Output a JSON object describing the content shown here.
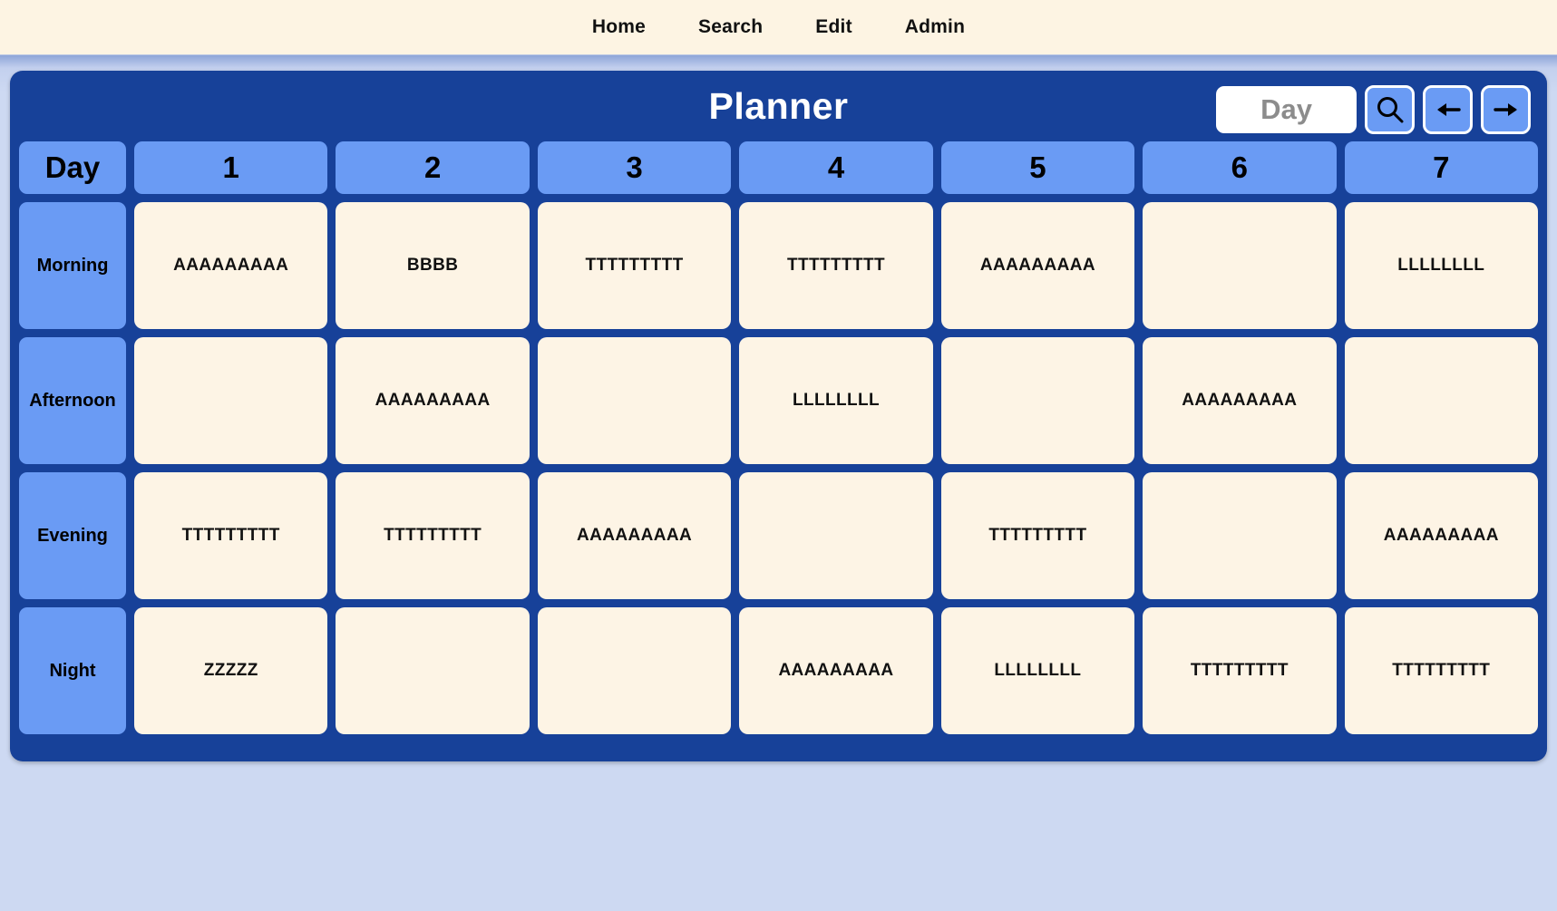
{
  "nav": {
    "items": [
      {
        "label": "Home"
      },
      {
        "label": "Search"
      },
      {
        "label": "Edit"
      },
      {
        "label": "Admin"
      }
    ]
  },
  "header": {
    "title": "Planner",
    "search_input": {
      "value": "",
      "placeholder": "Day"
    },
    "buttons": [
      {
        "name": "search-button",
        "icon": "search-icon"
      },
      {
        "name": "previous-button",
        "icon": "arrow-left-icon"
      },
      {
        "name": "next-button",
        "icon": "arrow-right-icon"
      }
    ]
  },
  "grid": {
    "corner_label": "Day",
    "day_headers": [
      "1",
      "2",
      "3",
      "4",
      "5",
      "6",
      "7"
    ],
    "row_labels": [
      "Morning",
      "Afternoon",
      "Evening",
      "Night"
    ],
    "rows": [
      [
        "AAAAAAAAA",
        "BBBB",
        "TTTTTTTTT",
        "TTTTTTTTT",
        "AAAAAAAAA",
        "",
        "LLLLLLLL"
      ],
      [
        "",
        "AAAAAAAAA",
        "",
        "LLLLLLLL",
        "",
        "AAAAAAAAA",
        ""
      ],
      [
        "TTTTTTTTT",
        "TTTTTTTTT",
        "AAAAAAAAA",
        "",
        "TTTTTTTTT",
        "",
        "AAAAAAAAA"
      ],
      [
        "ZZZZZ",
        "",
        "",
        "AAAAAAAAA",
        "LLLLLLLL",
        "TTTTTTTTT",
        "TTTTTTTTT"
      ]
    ]
  },
  "colors": {
    "panel": "#174199",
    "header_cell": "#6a9bf4",
    "content_cell": "#fdf4e5",
    "page_background": "#cdd9f2",
    "nav_background": "#fdf4e3"
  }
}
